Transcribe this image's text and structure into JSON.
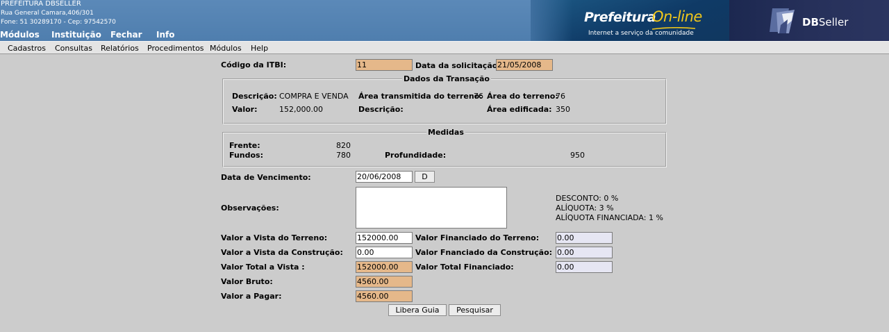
{
  "header": {
    "org_name": "PREFEITURA DBSELLER",
    "address": "Rua General Camara,406/301",
    "contact": "Fone: 51 30289170  -  Cep: 97542570",
    "top_menu": [
      "Módulos",
      "Instituição",
      "Fechar",
      "Info"
    ],
    "brand_prefeitura": "Prefeitura",
    "brand_online": "On-line",
    "brand_tagline": "Internet a serviço da comunidade",
    "dbseller_bold": "DB",
    "dbseller_rest": "Seller"
  },
  "menubar": {
    "items": [
      "Cadastros",
      "Consultas",
      "Relatórios",
      "Procedimentos",
      "Módulos",
      "Help"
    ]
  },
  "form": {
    "codigo_itbi_label": "Código da ITBI:",
    "codigo_itbi_value": "11",
    "data_solicitacao_label": "Data da solicitação:",
    "data_solicitacao_value": "21/05/2008",
    "transacao": {
      "legend": "Dados da Transação",
      "descricao_label": "Descrição:",
      "descricao_value": "COMPRA E VENDA",
      "area_transmitida_label": "Área transmitida do terreno:",
      "area_transmitida_value": "76",
      "area_terreno_label": "Área do terreno:",
      "area_terreno_value": "76",
      "valor_label": "Valor:",
      "valor_value": "152,000.00",
      "descricao2_label": "Descrição:",
      "area_edificada_label": "Área edificada:",
      "area_edificada_value": "350"
    },
    "medidas": {
      "legend": "Medidas",
      "frente_label": "Frente:",
      "frente_value": "820",
      "fundos_label": "Fundos:",
      "fundos_value": "780",
      "profundidade_label": "Profundidade:",
      "profundidade_value": "950"
    },
    "vencimento_label": "Data de Vencimento:",
    "vencimento_value": "20/06/2008",
    "vencimento_button": "D",
    "observacoes_label": "Observações:",
    "observacoes_value": "",
    "desconto": "DESCONTO: 0 %",
    "aliquota": "ALÍQUOTA: 3 %",
    "aliquota_financiada": "ALÍQUOTA FINANCIADA: 1 %",
    "vista_terreno_label": "Valor a Vista do Terreno:",
    "vista_terreno_value": "152000.00",
    "financiado_terreno_label": "Valor Financiado do Terreno:",
    "financiado_terreno_value": "0.00",
    "vista_construcao_label": "Valor a Vista da Construção:",
    "vista_construcao_value": "0.00",
    "financiado_construcao_label": "Valor Fnanciado da Construção:",
    "financiado_construcao_value": "0.00",
    "total_vista_label": "Valor Total a Vista :",
    "total_vista_value": "152000.00",
    "total_financiado_label": "Valor Total Financiado:",
    "total_financiado_value": "0.00",
    "bruto_label": "Valor Bruto:",
    "bruto_value": "4560.00",
    "pagar_label": "Valor a Pagar:",
    "pagar_value": "4560.00",
    "libera_button": "Libera Guia",
    "pesquisar_button": "Pesquisar"
  },
  "colors": {
    "header_blue": "#5b89b8",
    "readonly_field": "#e5b88a",
    "financed_field": "#e6e6f3",
    "brand_yellow": "#f2c81a"
  }
}
